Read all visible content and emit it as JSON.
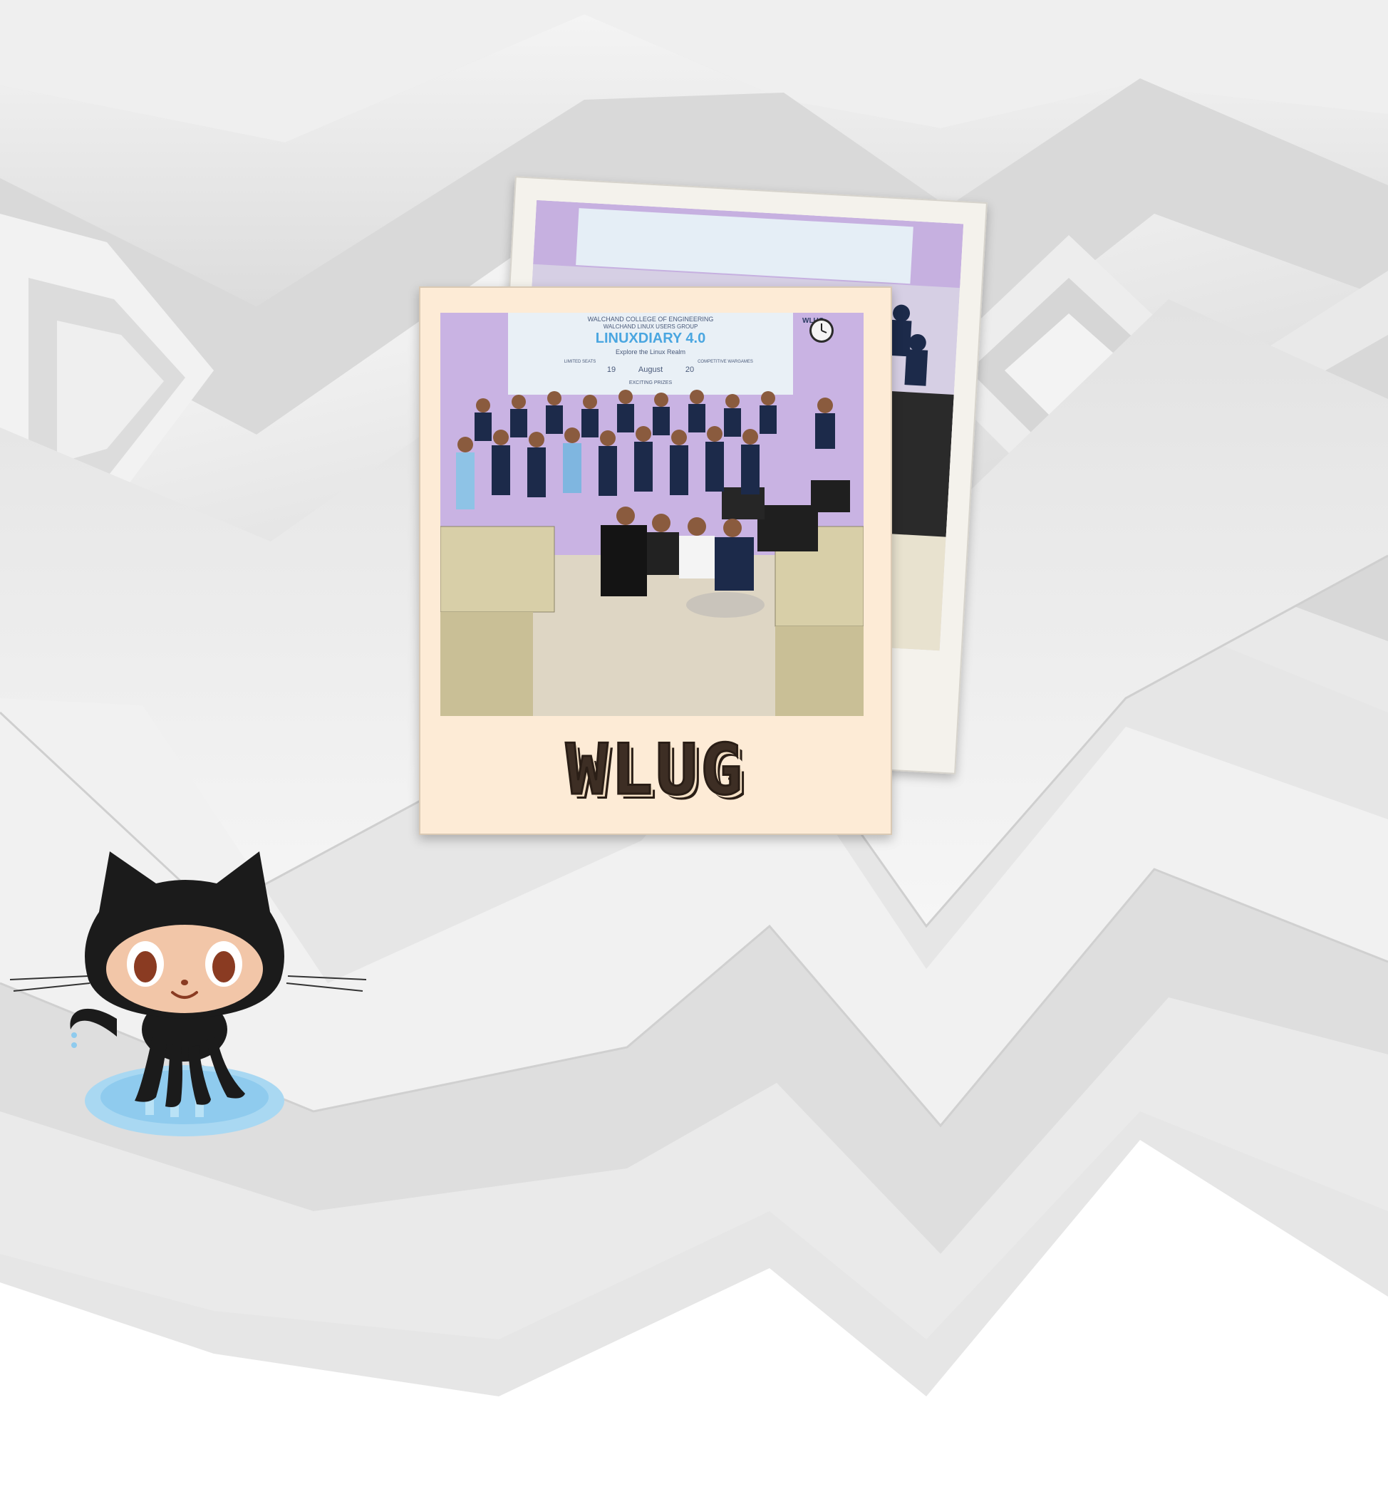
{
  "polaroid": {
    "caption": "WLUG",
    "banner": {
      "college": "WALCHAND COLLEGE OF ENGINEERING",
      "group": "WALCHAND LINUX USERS GROUP",
      "event": "LINUXDIARY 4.0",
      "tagline": "Explore the Linux Realm",
      "month": "August",
      "date_start": "19",
      "date_end": "20",
      "badge_left": "LIMITED SEATS",
      "badge_right": "COMPETITIVE WARGAMES",
      "prizes": "EXCITING PRIZES",
      "logo": "WLUG"
    }
  },
  "colors": {
    "paper_front": "#fdebd6",
    "paper_back": "#f4f2ec",
    "caption_text": "#3d2e24",
    "banner_accent": "#4aa6e0",
    "wall": "#c9b3e3",
    "shirts": "#1c2a4a"
  },
  "icons": [
    "octocat-mascot-icon",
    "wall-clock-icon"
  ]
}
